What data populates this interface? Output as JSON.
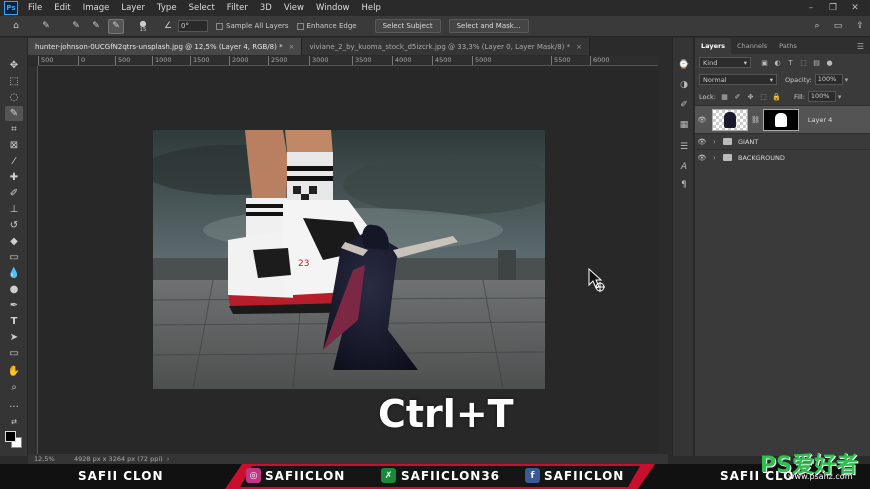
{
  "menu": {
    "logo": "Ps",
    "items": [
      "File",
      "Edit",
      "Image",
      "Layer",
      "Type",
      "Select",
      "Filter",
      "3D",
      "View",
      "Window",
      "Help"
    ]
  },
  "options": {
    "brush_size": "15",
    "angle": "0°",
    "sample_all_layers": "Sample All Layers",
    "enhance_edge": "Enhance Edge",
    "select_subject": "Select Subject",
    "select_and_mask": "Select and Mask..."
  },
  "tabs": [
    {
      "label": "hunter-johnson-0UCGfN2qtrs-unsplash.jpg @ 12,5% (Layer 4, RGB/8) *",
      "close": "×"
    },
    {
      "label": "viviane_2_by_kuoma_stock_d5izcrk.jpg @ 33,3% (Layer 0, Layer Mask/8) *",
      "close": "×"
    }
  ],
  "ruler": [
    "500",
    "0",
    "500",
    "1000",
    "1500",
    "2000",
    "2500",
    "3000",
    "3500",
    "4000",
    "4500",
    "5000",
    "5500",
    "6000"
  ],
  "status": {
    "zoom": "12,5%",
    "doc_size": "4928 px x 3264 px (72 ppi)"
  },
  "overlay": {
    "shortcut": "Ctrl+T"
  },
  "layers_panel": {
    "tabs": [
      "Layers",
      "Channels",
      "Paths"
    ],
    "kind": "Kind",
    "blend_mode": "Normal",
    "opacity_label": "Opacity:",
    "opacity": "100%",
    "lock_label": "Lock:",
    "fill_label": "Fill:",
    "fill": "100%",
    "layers": [
      {
        "name": "Layer 4"
      },
      {
        "name": "GIANT"
      },
      {
        "name": "BACKGROUND"
      }
    ]
  },
  "banner": {
    "left": "SAFII CLON",
    "instagram": "SAFIICLON",
    "x": "SAFIICLON36",
    "facebook": "SAFIICLON",
    "right": "SAFII CLO"
  },
  "watermark": {
    "logo": "PS爱好者",
    "url": "www.psahz.com"
  },
  "colors": {
    "accent": "#31a8ff",
    "banner_red": "#c8102e",
    "watermark_green": "#2fbf4f"
  }
}
